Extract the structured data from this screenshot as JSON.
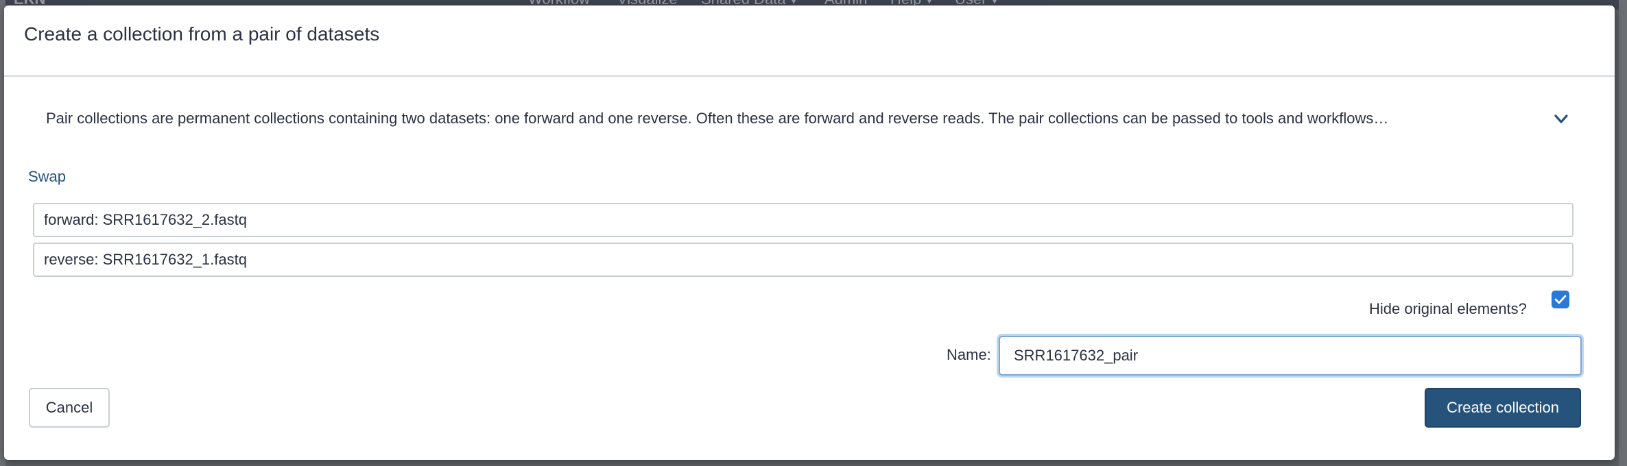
{
  "background": {
    "logo": "EKN",
    "nav_items": [
      "Workflow",
      "Visualize",
      "Shared Data ▾",
      "Admin",
      "Help ▾",
      "User ▾"
    ]
  },
  "modal": {
    "title": "Create a collection from a pair of datasets",
    "help_text": "Pair collections are permanent collections containing two datasets: one forward and one reverse. Often these are forward and reverse reads. The pair collections can be passed to tools and workflows…",
    "expand_icon": "chevron-down-icon",
    "swap_label": "Swap",
    "forward_label": "forward: SRR1617632_2.fastq",
    "reverse_label": "reverse: SRR1617632_1.fastq",
    "hide_original_label": "Hide original elements?",
    "hide_original_checked": true,
    "name_label": "Name:",
    "name_value": "SRR1617632_pair",
    "cancel_label": "Cancel",
    "create_label": "Create collection"
  },
  "colors": {
    "accent": "#25537b",
    "checkbox": "#2a79d8",
    "text": "#2c3143"
  }
}
